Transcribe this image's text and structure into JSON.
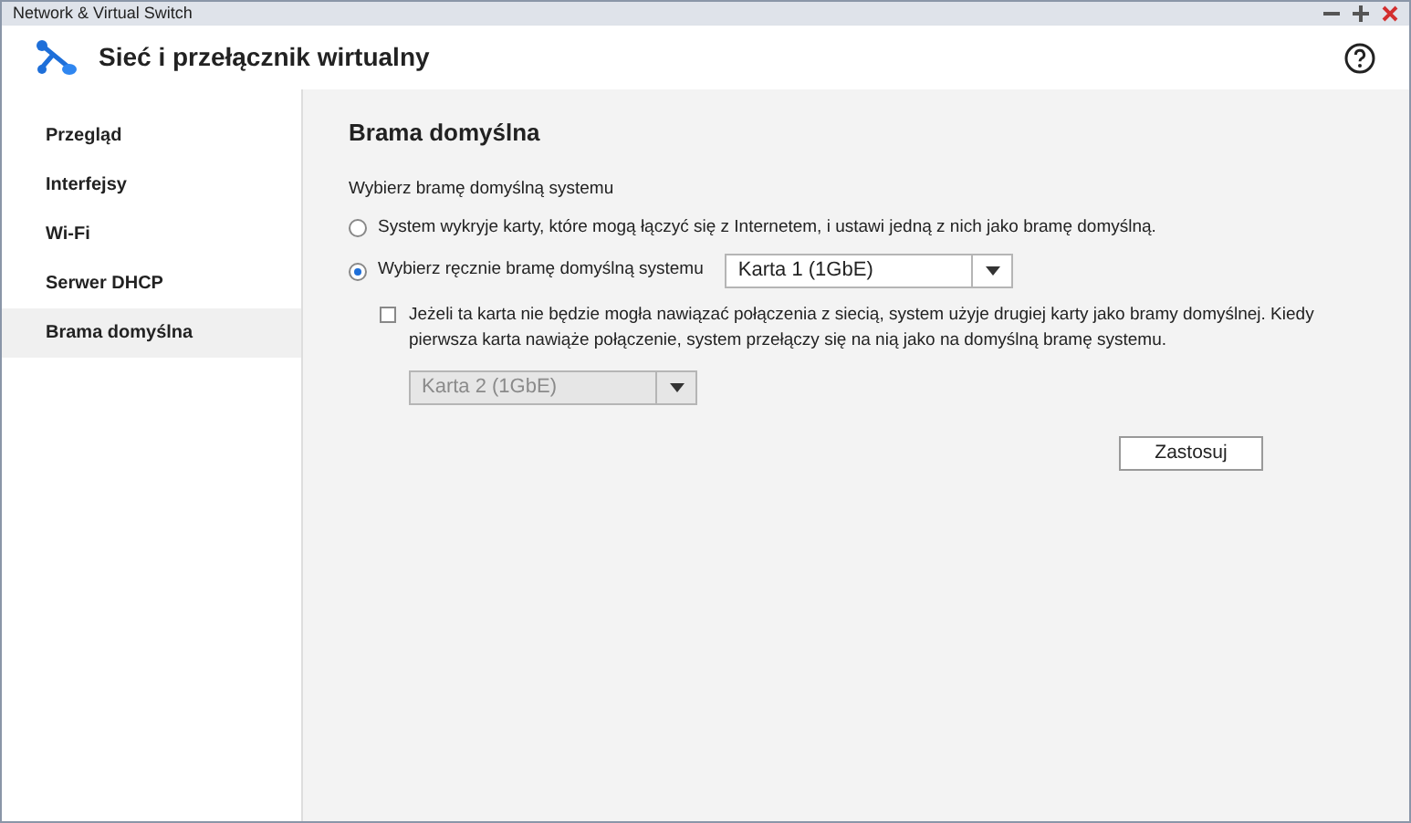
{
  "window": {
    "title": "Network & Virtual Switch"
  },
  "app": {
    "title": "Sieć i przełącznik wirtualny"
  },
  "sidebar": {
    "items": [
      {
        "label": "Przegląd",
        "selected": false
      },
      {
        "label": "Interfejsy",
        "selected": false
      },
      {
        "label": "Wi-Fi",
        "selected": false
      },
      {
        "label": "Serwer DHCP",
        "selected": false
      },
      {
        "label": "Brama domyślna",
        "selected": true
      }
    ]
  },
  "page": {
    "title": "Brama domyślna",
    "section_label": "Wybierz bramę domyślną systemu",
    "options": [
      {
        "label": "System wykryje karty, które mogą łączyć się z Internetem, i ustawi jedną z nich jako bramę domyślną.",
        "selected": false
      },
      {
        "label": "Wybierz ręcznie bramę domyślną systemu",
        "selected": true,
        "select": {
          "value": "Karta 1 (1GbE)",
          "disabled": false
        }
      }
    ],
    "fallback": {
      "label": "Jeżeli ta karta nie będzie mogła nawiązać połączenia z siecią, system użyje drugiej karty jako bramy domyślnej. Kiedy pierwsza karta nawiąże połączenie, system przełączy się na nią jako na domyślną bramę systemu.",
      "checked": false,
      "select": {
        "value": "Karta 2 (1GbE)",
        "disabled": true
      }
    },
    "apply_button": "Zastosuj"
  }
}
